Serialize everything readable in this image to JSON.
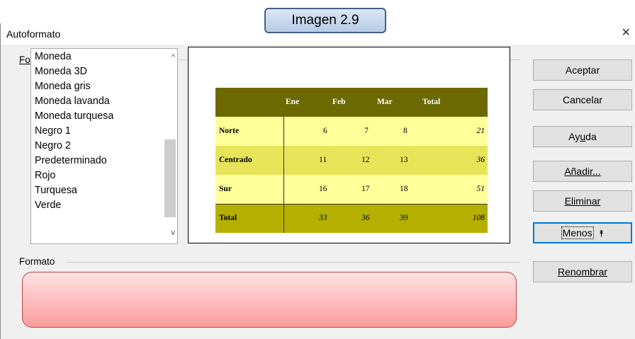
{
  "callout": {
    "text": "Imagen 2.9"
  },
  "window": {
    "title": "Autoformato",
    "close_glyph": "×"
  },
  "format_group": {
    "label": "Formato"
  },
  "format_list": {
    "items": [
      "Moneda",
      "Moneda 3D",
      "Moneda gris",
      "Moneda lavanda",
      "Moneda turquesa",
      "Negro 1",
      "Negro 2",
      "Predeterminado",
      "Rojo",
      "Turquesa",
      "Verde"
    ],
    "scroll_up": "^",
    "scroll_down": "v"
  },
  "preview": {
    "header": [
      "",
      "Ene",
      "Feb",
      "Mar",
      "Total"
    ],
    "rows": [
      [
        "Norte",
        "6",
        "7",
        "8",
        "21"
      ],
      [
        "Centrado",
        "11",
        "12",
        "13",
        "36"
      ],
      [
        "Sur",
        "16",
        "17",
        "18",
        "51"
      ],
      [
        "Total",
        "33",
        "36",
        "39",
        "108"
      ]
    ],
    "colors": {
      "header": "#6b6900",
      "light": "#ffff99",
      "mid": "#e8e45a",
      "total": "#b5b000"
    }
  },
  "buttons": {
    "aceptar": "Aceptar",
    "cancelar": "Cancelar",
    "ayuda": "Ayuda",
    "anadir": "Añadir...",
    "eliminar": "Eliminar",
    "menos": "Menos",
    "menos_icon": "⯭",
    "renombrar": "Renombrar"
  },
  "formatting_group": {
    "label": "Formato"
  }
}
